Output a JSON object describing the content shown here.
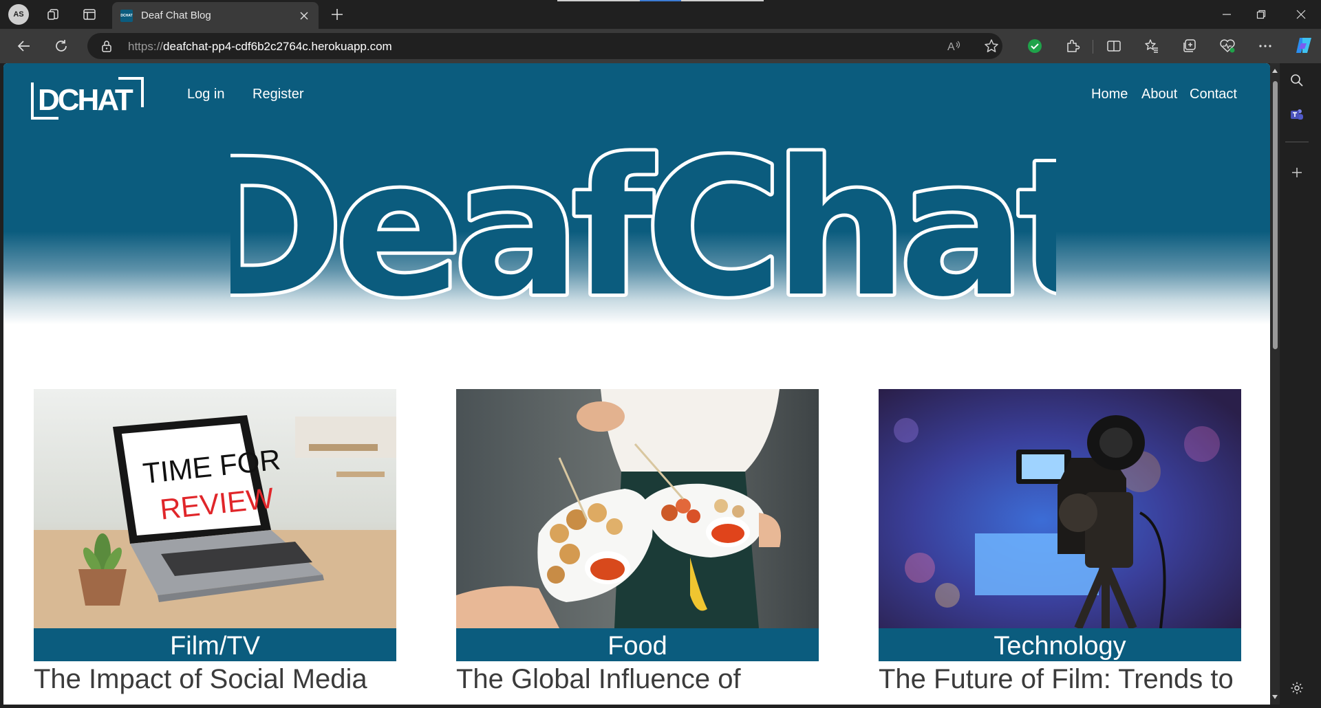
{
  "browser": {
    "profile_initials": "AS",
    "tab_title": "Deaf Chat Blog",
    "tab_favicon_text": "DCHAT",
    "url_scheme": "https://",
    "url_host": "deafchat-pp4-cdf6b2c2764c.herokuapp.com",
    "read_aloud_label": "A"
  },
  "site": {
    "logo_text": "DCHAT",
    "nav_left": [
      "Log in",
      "Register"
    ],
    "nav_right": [
      "Home",
      "About",
      "Contact"
    ],
    "hero_title": "DeafChat",
    "colors": {
      "brand": "#0b5c7e",
      "title_text": "#3b3b3b"
    }
  },
  "posts": [
    {
      "category": "Film/TV",
      "title": "The Impact of Social Media",
      "image_text_1": "TIME FOR",
      "image_text_2": "REVIEW"
    },
    {
      "category": "Food",
      "title": "The Global Influence of"
    },
    {
      "category": "Technology",
      "title": "The Future of Film: Trends to"
    }
  ]
}
